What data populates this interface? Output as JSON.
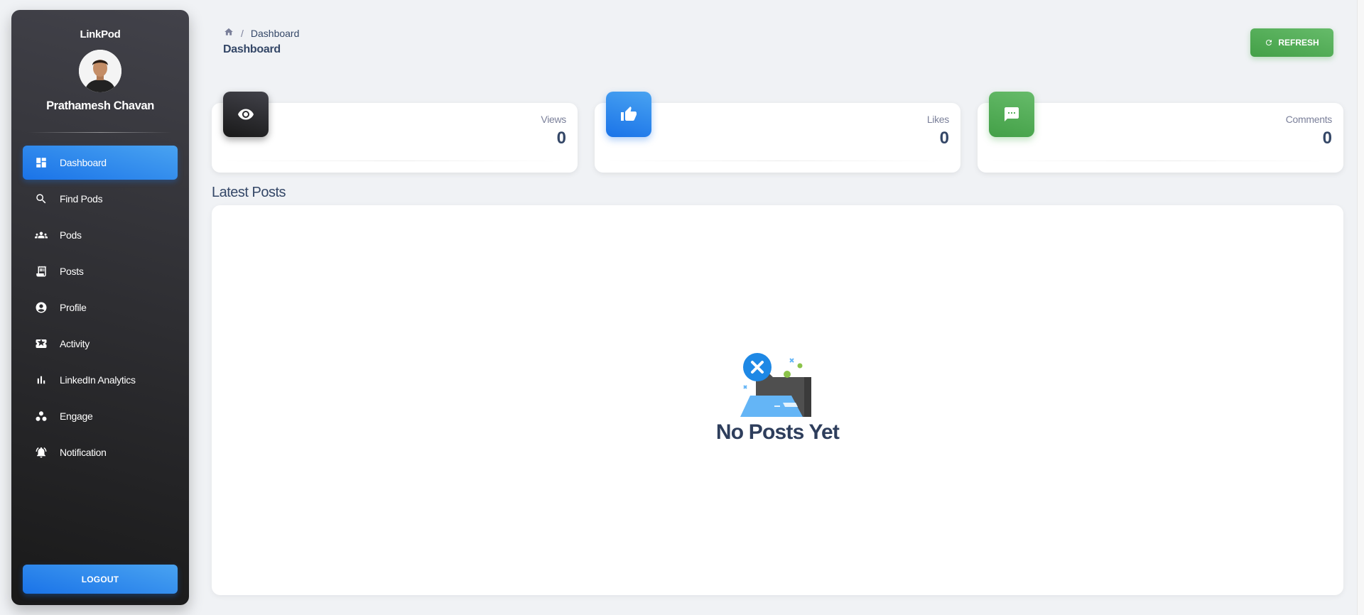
{
  "sidebar": {
    "brand": "LinkPod",
    "user_name": "Prathamesh Chavan",
    "items": [
      {
        "label": "Dashboard",
        "icon": "dashboard-icon",
        "active": true
      },
      {
        "label": "Find Pods",
        "icon": "search-icon"
      },
      {
        "label": "Pods",
        "icon": "groups-icon"
      },
      {
        "label": "Posts",
        "icon": "receipt-icon"
      },
      {
        "label": "Profile",
        "icon": "account-circle-icon"
      },
      {
        "label": "Activity",
        "icon": "ticket-icon"
      },
      {
        "label": "LinkedIn Analytics",
        "icon": "bar-chart-icon"
      },
      {
        "label": "Engage",
        "icon": "workspaces-icon"
      },
      {
        "label": "Notification",
        "icon": "bell-icon"
      }
    ],
    "logout_label": "LOGOUT"
  },
  "header": {
    "breadcrumb_current": "Dashboard",
    "title": "Dashboard",
    "refresh_label": "REFRESH"
  },
  "stats": [
    {
      "label": "Views",
      "value": "0",
      "icon": "eye-icon"
    },
    {
      "label": "Likes",
      "value": "0",
      "icon": "thumb-up-icon"
    },
    {
      "label": "Comments",
      "value": "0",
      "icon": "comment-icon"
    }
  ],
  "latest_posts": {
    "title": "Latest Posts",
    "empty_message": "No Posts Yet"
  },
  "colors": {
    "primary": "#1a73e8",
    "success": "#43a047",
    "dark": "#191919",
    "background": "#f0f2f5"
  }
}
